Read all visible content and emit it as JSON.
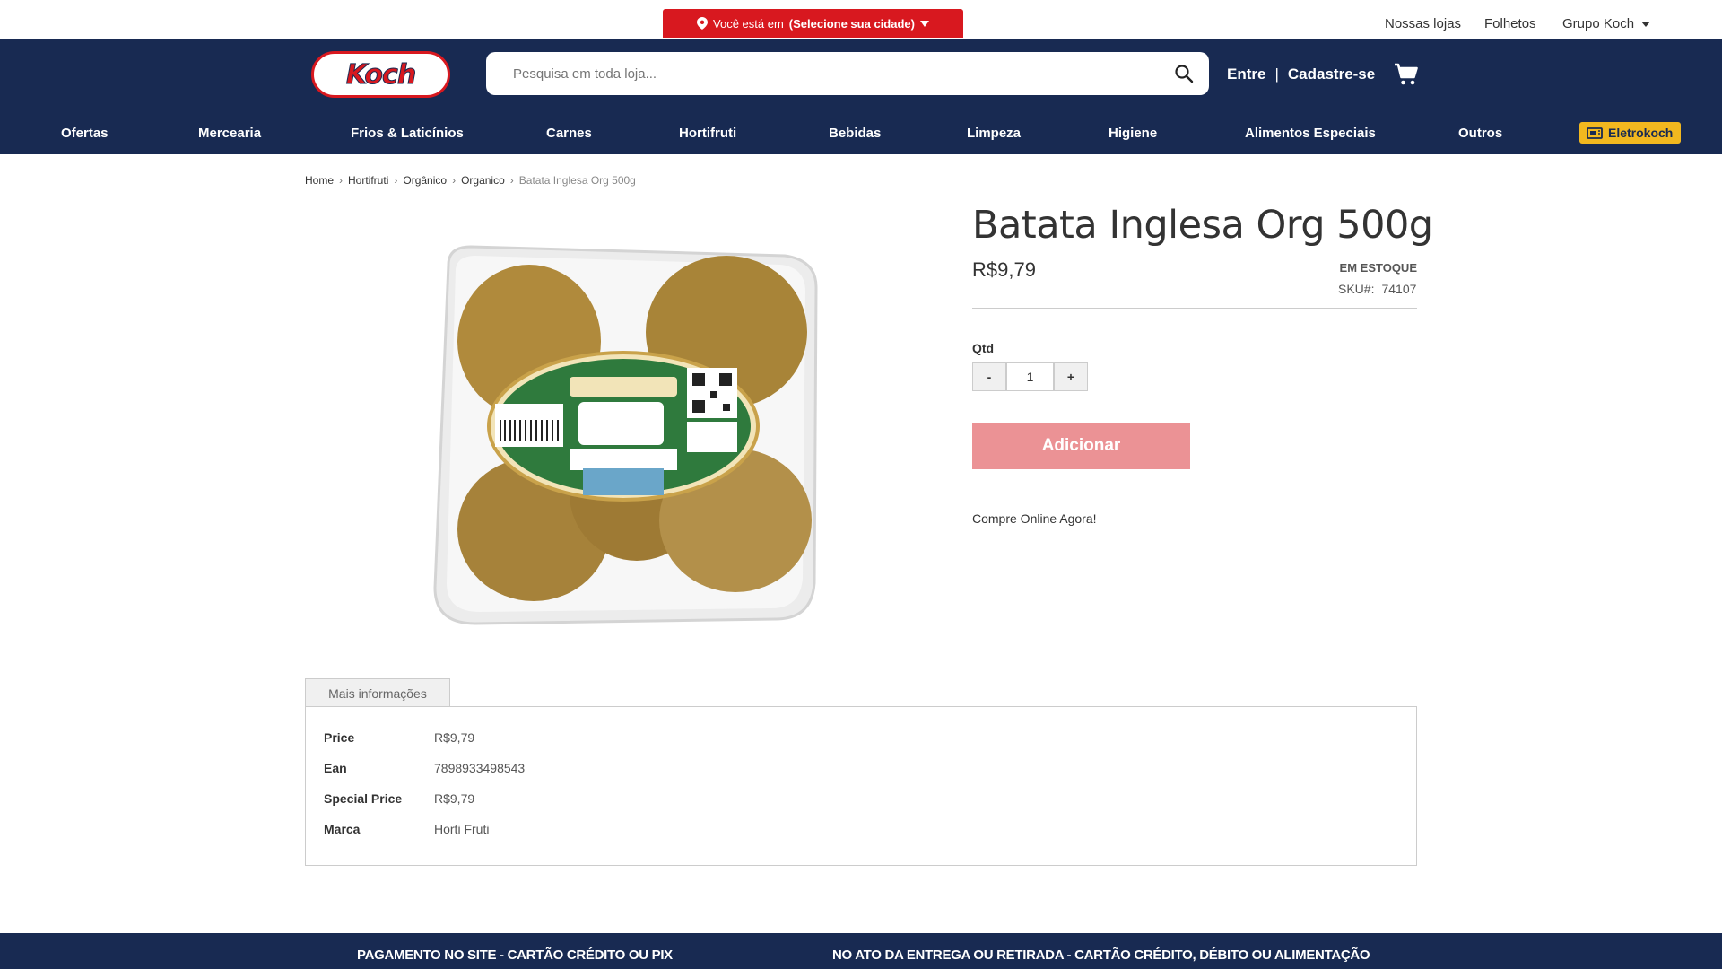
{
  "topbar": {
    "city_prefix": "Você está em",
    "city_select": "(Selecione sua cidade)",
    "links": [
      "Nossas lojas",
      "Folhetos",
      "Grupo Koch"
    ]
  },
  "header": {
    "logo_text": "Koch",
    "search_placeholder": "Pesquisa em toda loja...",
    "login": "Entre",
    "separator": "|",
    "register": "Cadastre-se"
  },
  "nav": {
    "items": [
      "Ofertas",
      "Mercearia",
      "Frios & Laticínios",
      "Carnes",
      "Hortifruti",
      "Bebidas",
      "Limpeza",
      "Higiene",
      "Alimentos Especiais",
      "Outros"
    ],
    "special": "Eletrokoch"
  },
  "breadcrumb": [
    "Home",
    "Hortifruti",
    "Orgânico",
    "Organico",
    "Batata Inglesa Org 500g"
  ],
  "product": {
    "title": "Batata Inglesa Org 500g",
    "price": "R$9,79",
    "stock": "EM ESTOQUE",
    "sku_label": "SKU#:",
    "sku": "74107",
    "qty_label": "Qtd",
    "qty_minus": "-",
    "qty_value": "1",
    "qty_plus": "+",
    "add_button": "Adicionar",
    "promo": "Compre Online Agora!"
  },
  "more_info": {
    "tab": "Mais informações",
    "rows": [
      {
        "k": "Price",
        "v": "R$9,79"
      },
      {
        "k": "Ean",
        "v": "7898933498543"
      },
      {
        "k": "Special Price",
        "v": "R$9,79"
      },
      {
        "k": "Marca",
        "v": "Horti Fruti"
      }
    ]
  },
  "footer": {
    "left": "PAGAMENTO NO SITE - CARTÃO CRÉDITO OU PIX",
    "right": "NO ATO DA ENTREGA OU RETIRADA - CARTÃO CRÉDITO, DÉBITO OU ALIMENTAÇÃO"
  },
  "colors": {
    "navy": "#182a52",
    "red": "#d8181f",
    "button": "#eb9295",
    "eletro": "#f2b81f"
  }
}
